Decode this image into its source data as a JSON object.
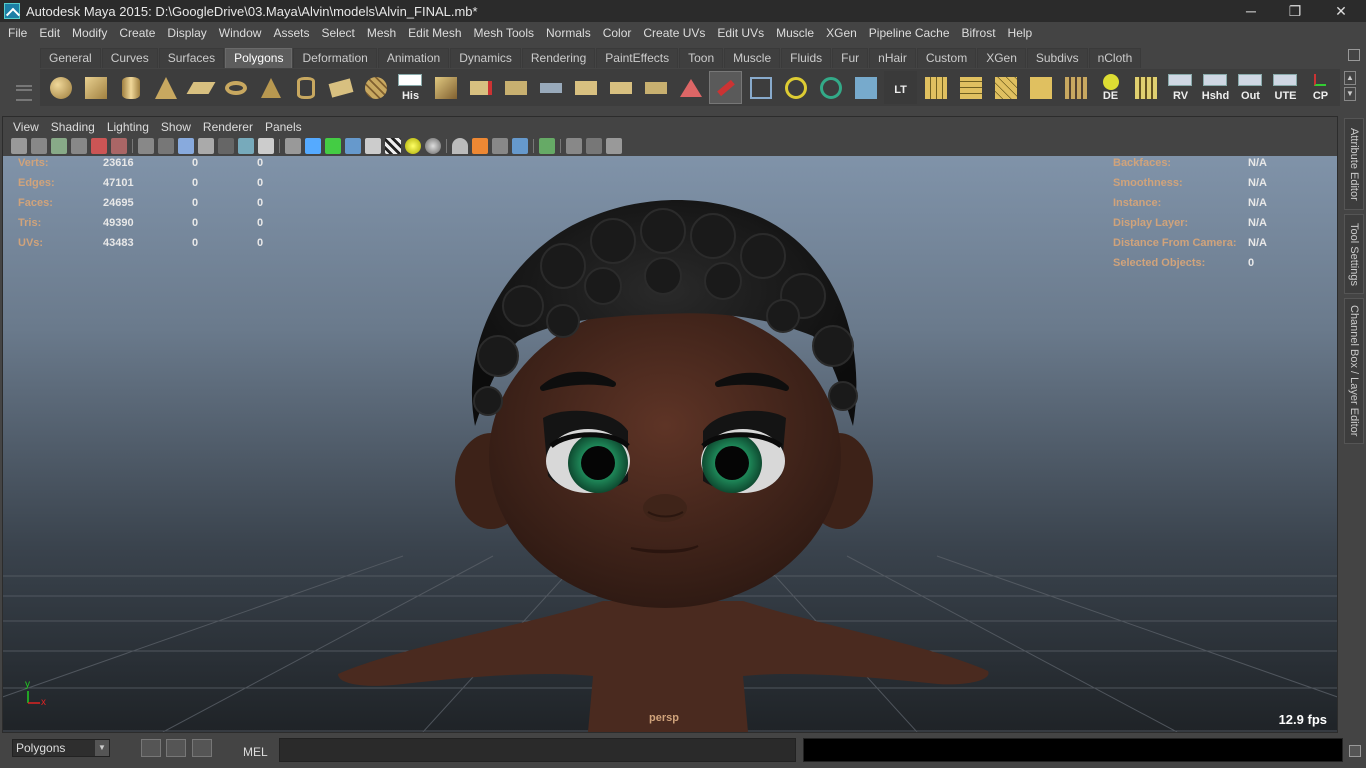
{
  "window": {
    "title": "Autodesk Maya 2015: D:\\GoogleDrive\\03.Maya\\Alvin\\models\\Alvin_FINAL.mb*",
    "minimize": "─",
    "restore": "❐",
    "close": "✕"
  },
  "menubar": [
    "File",
    "Edit",
    "Modify",
    "Create",
    "Display",
    "Window",
    "Assets",
    "Select",
    "Mesh",
    "Edit Mesh",
    "Mesh Tools",
    "Normals",
    "Color",
    "Create UVs",
    "Edit UVs",
    "Muscle",
    "XGen",
    "Pipeline Cache",
    "Bifrost",
    "Help"
  ],
  "shelf": {
    "tabs": [
      "General",
      "Curves",
      "Surfaces",
      "Polygons",
      "Deformation",
      "Animation",
      "Dynamics",
      "Rendering",
      "PaintEffects",
      "Toon",
      "Muscle",
      "Fluids",
      "Fur",
      "nHair",
      "Custom",
      "XGen",
      "Subdivs",
      "nCloth"
    ],
    "active_tab": "Polygons",
    "icons": [
      "poly-sphere-icon",
      "poly-cube-icon",
      "poly-cylinder-icon",
      "poly-cone-icon",
      "poly-plane-icon",
      "poly-torus-icon",
      "poly-pyramid-icon",
      "poly-pipe-icon",
      "platonic-icon",
      "soccer-ball-icon"
    ],
    "labels": {
      "his": "His",
      "lt": "LT",
      "de": "DE",
      "rv": "RV",
      "hshd": "Hshd",
      "out": "Out",
      "ute": "UTE",
      "cp": "CP"
    },
    "scroll_up": "▲",
    "scroll_down": "▼"
  },
  "panel": {
    "menu": [
      "View",
      "Shading",
      "Lighting",
      "Show",
      "Renderer",
      "Panels"
    ]
  },
  "hud": {
    "left": [
      {
        "label": "Verts:",
        "v1": "23616",
        "v2": "0",
        "v3": "0"
      },
      {
        "label": "Edges:",
        "v1": "47101",
        "v2": "0",
        "v3": "0"
      },
      {
        "label": "Faces:",
        "v1": "24695",
        "v2": "0",
        "v3": "0"
      },
      {
        "label": "Tris:",
        "v1": "49390",
        "v2": "0",
        "v3": "0"
      },
      {
        "label": "UVs:",
        "v1": "43483",
        "v2": "0",
        "v3": "0"
      }
    ],
    "right": [
      {
        "label": "Backfaces:",
        "value": "N/A"
      },
      {
        "label": "Smoothness:",
        "value": "N/A"
      },
      {
        "label": "Instance:",
        "value": "N/A"
      },
      {
        "label": "Display Layer:",
        "value": "N/A"
      },
      {
        "label": "Distance From Camera:",
        "value": "N/A"
      },
      {
        "label": "Selected Objects:",
        "value": "0"
      }
    ],
    "camera": "persp",
    "fps": "12.9 fps",
    "axis_x": "x",
    "axis_y": "y"
  },
  "side_tabs": [
    "Attribute Editor",
    "Tool Settings",
    "Channel Box / Layer Editor"
  ],
  "bottom": {
    "menu_set": "Polygons",
    "menu_set_arrow": "▼",
    "mel_label": "MEL"
  },
  "colors": {
    "hud_label": "#d0a37b",
    "skin": "#4a2a1f",
    "hair": "#151515",
    "iris": "#1f8a5a"
  }
}
